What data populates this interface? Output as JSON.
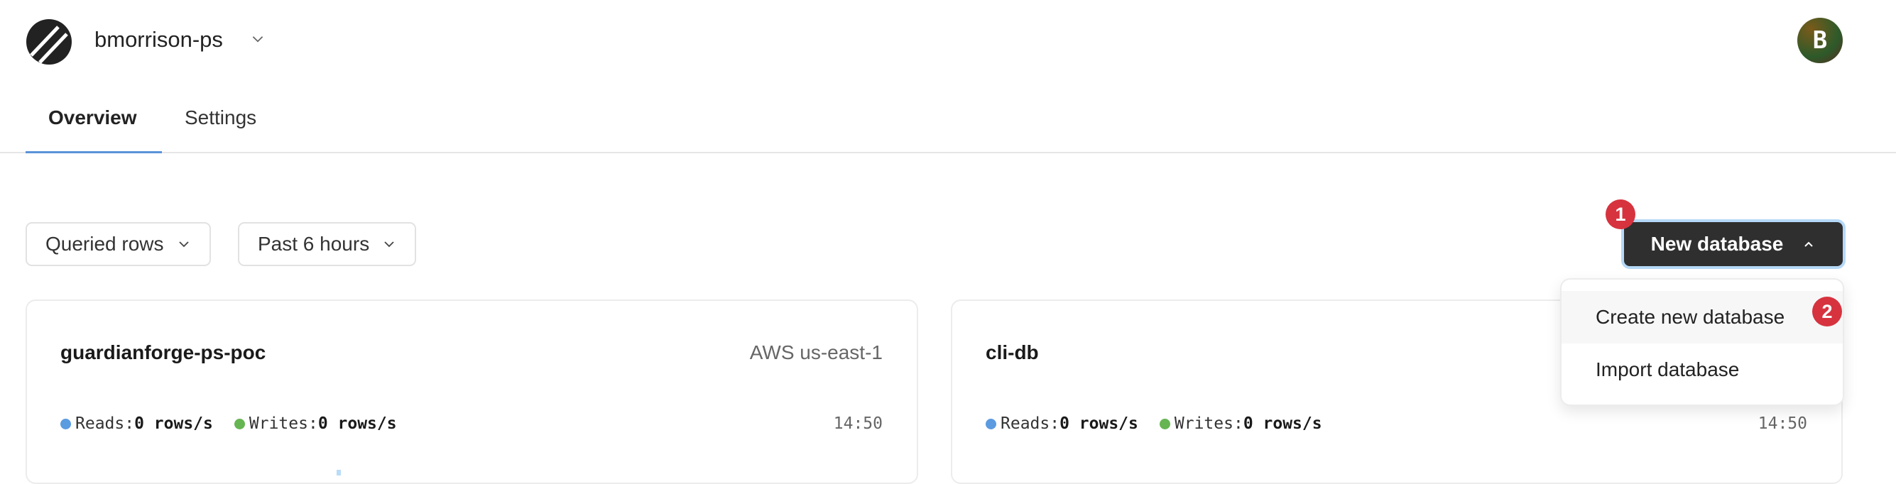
{
  "header": {
    "org_name": "bmorrison-ps",
    "avatar_initial": "B"
  },
  "tabs": [
    {
      "label": "Overview",
      "active": true
    },
    {
      "label": "Settings",
      "active": false
    }
  ],
  "filters": {
    "metric": "Queried rows",
    "range": "Past 6 hours"
  },
  "new_database": {
    "label": "New database",
    "menu": [
      "Create new database",
      "Import database"
    ]
  },
  "badges": [
    "1",
    "2"
  ],
  "databases": [
    {
      "name": "guardianforge-ps-poc",
      "region": "AWS us-east-1",
      "reads_label": "Reads:",
      "reads": "0 rows/s",
      "writes_label": "Writes:",
      "writes": "0 rows/s",
      "time": "14:50"
    },
    {
      "name": "cli-db",
      "reads_label": "Reads:",
      "reads": "0 rows/s",
      "writes_label": "Writes:",
      "writes": "0 rows/s",
      "time": "14:50"
    }
  ],
  "colors": {
    "reads": "#5b9be0",
    "writes": "#66b553",
    "accent": "#d6333f"
  }
}
